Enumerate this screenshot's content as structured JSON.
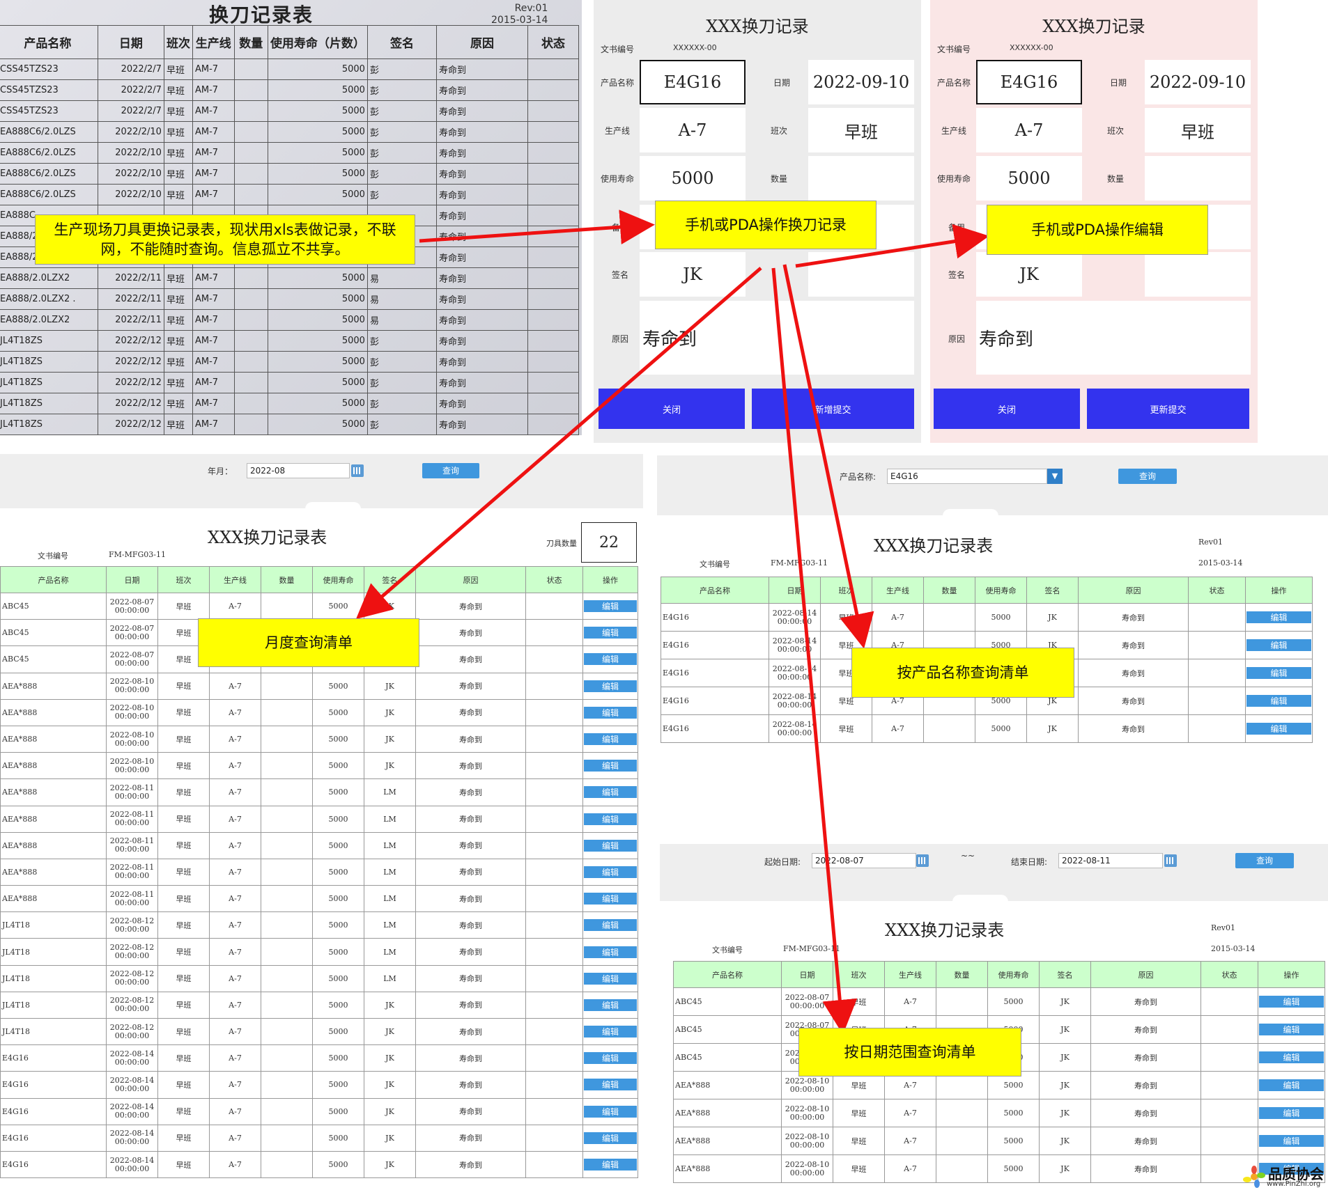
{
  "photo": {
    "title": "换刀记录表",
    "rev": "Rev:01",
    "date": "2015-03-14",
    "headers": [
      "产品名称",
      "日期",
      "班次",
      "生产线",
      "数量",
      "使用寿命（片数）",
      "签名",
      "原因",
      "状态"
    ],
    "rows": [
      [
        "CSS45TZS23",
        "2022/2/7",
        "早班",
        "AM-7",
        "",
        "5000",
        "彭",
        "寿命到",
        ""
      ],
      [
        "CSS45TZS23",
        "2022/2/7",
        "早班",
        "AM-7",
        "",
        "5000",
        "彭",
        "寿命到",
        ""
      ],
      [
        "CSS45TZS23",
        "2022/2/7",
        "早班",
        "AM-7",
        "",
        "5000",
        "彭",
        "寿命到",
        ""
      ],
      [
        "EA888C6/2.0LZS",
        "2022/2/10",
        "早班",
        "AM-7",
        "",
        "5000",
        "彭",
        "寿命到",
        ""
      ],
      [
        "EA888C6/2.0LZS",
        "2022/2/10",
        "早班",
        "AM-7",
        "",
        "5000",
        "彭",
        "寿命到",
        ""
      ],
      [
        "EA888C6/2.0LZS",
        "2022/2/10",
        "早班",
        "AM-7",
        "",
        "5000",
        "彭",
        "寿命到",
        ""
      ],
      [
        "EA888C6/2.0LZS",
        "2022/2/10",
        "早班",
        "AM-7",
        "",
        "5000",
        "彭",
        "寿命到",
        ""
      ],
      [
        "EA888C",
        "",
        "",
        "",
        "",
        "",
        "",
        "寿命到",
        ""
      ],
      [
        "EA888/2",
        "",
        "",
        "",
        "",
        "",
        "",
        "寿命到",
        ""
      ],
      [
        "EA888/2.0LZX2",
        "2022/2/11",
        "早班",
        "AM-7",
        "",
        "5000",
        "易",
        "寿命到",
        ""
      ],
      [
        "EA888/2.0LZX2",
        "2022/2/11",
        "早班",
        "AM-7",
        "",
        "5000",
        "易",
        "寿命到",
        ""
      ],
      [
        "EA888/2.0LZX2 .",
        "2022/2/11",
        "早班",
        "AM-7",
        "",
        "5000",
        "易",
        "寿命到",
        ""
      ],
      [
        "EA888/2.0LZX2",
        "2022/2/11",
        "早班",
        "AM-7",
        "",
        "5000",
        "易",
        "寿命到",
        ""
      ],
      [
        "JL4T18ZS",
        "2022/2/12",
        "早班",
        "AM-7",
        "",
        "5000",
        "彭",
        "寿命到",
        ""
      ],
      [
        "JL4T18ZS",
        "2022/2/12",
        "早班",
        "AM-7",
        "",
        "5000",
        "彭",
        "寿命到",
        ""
      ],
      [
        "JL4T18ZS",
        "2022/2/12",
        "早班",
        "AM-7",
        "",
        "5000",
        "彭",
        "寿命到",
        ""
      ],
      [
        "JL4T18ZS",
        "2022/2/12",
        "早班",
        "AM-7",
        "",
        "5000",
        "彭",
        "寿命到",
        ""
      ],
      [
        "JL4T18ZS",
        "2022/2/12",
        "早班",
        "AM-7",
        "",
        "5000",
        "彭",
        "寿命到",
        ""
      ]
    ]
  },
  "form_add": {
    "title": "XXX换刀记录",
    "doc_label": "文书编号",
    "doc_value": "XXXXXX-00",
    "product_label": "产品名称",
    "product_value": "E4G16",
    "date_label": "日期",
    "date_value": "2022-09-10",
    "line_label": "生产线",
    "line_value": "A-7",
    "shift_label": "班次",
    "shift_value": "早班",
    "life_label": "使用寿命",
    "life_value": "5000",
    "qty_label": "数量",
    "spare_label": "备用",
    "sign_label": "签名",
    "sign_value": "JK",
    "reason_label": "原因",
    "reason_value": "寿命到",
    "close_btn": "关闭",
    "submit_btn": "新增提交"
  },
  "form_edit": {
    "title": "XXX换刀记录",
    "doc_label": "文书编号",
    "doc_value": "XXXXXX-00",
    "product_label": "产品名称",
    "product_value": "E4G16",
    "date_label": "日期",
    "date_value": "2022-09-10",
    "line_label": "生产线",
    "line_value": "A-7",
    "shift_label": "班次",
    "shift_value": "早班",
    "life_label": "使用寿命",
    "life_value": "5000",
    "qty_label": "数量",
    "spare_label": "备用",
    "sign_label": "签名",
    "sign_value": "JK",
    "reason_label": "原因",
    "reason_value": "寿命到",
    "close_btn": "关闭",
    "submit_btn": "更新提交"
  },
  "callouts": {
    "photo": "生产现场刀具更换记录表，现状用xls表做记录，不联网，不能随时查询。信息孤立不共享。",
    "pda_add": "手机或PDA操作换刀记录",
    "pda_edit": "手机或PDA操作编辑",
    "monthly": "月度查询清单",
    "by_product": "按产品名称查询清单",
    "by_date": "按日期范围查询清单"
  },
  "monthly": {
    "query_label": "年月：",
    "query_value": "2022-08",
    "query_btn": "查询",
    "title": "XXX换刀记录表",
    "doc_label": "文书编号",
    "doc_value": "FM-MFG03-11",
    "count_label": "刀具数量",
    "count_value": "22",
    "headers": [
      "产品名称",
      "日期",
      "班次",
      "生产线",
      "数量",
      "使用寿命",
      "签名",
      "原因",
      "状态",
      "操作"
    ],
    "edit_label": "编辑",
    "rows": [
      [
        "ABC45",
        "2022-08-07",
        "00:00:00",
        "早班",
        "A-7",
        "",
        "5000",
        "JK",
        "寿命到",
        ""
      ],
      [
        "ABC45",
        "2022-08-07",
        "00:00:00",
        "早班",
        "A-7",
        "",
        "5000",
        "JK",
        "寿命到",
        ""
      ],
      [
        "ABC45",
        "2022-08-07",
        "00:00:00",
        "早班",
        "A-7",
        "",
        "5000",
        "JK",
        "寿命到",
        ""
      ],
      [
        "AEA*888",
        "2022-08-10",
        "00:00:00",
        "早班",
        "A-7",
        "",
        "5000",
        "JK",
        "寿命到",
        ""
      ],
      [
        "AEA*888",
        "2022-08-10",
        "00:00:00",
        "早班",
        "A-7",
        "",
        "5000",
        "JK",
        "寿命到",
        ""
      ],
      [
        "AEA*888",
        "2022-08-10",
        "00:00:00",
        "早班",
        "A-7",
        "",
        "5000",
        "JK",
        "寿命到",
        ""
      ],
      [
        "AEA*888",
        "2022-08-10",
        "00:00:00",
        "早班",
        "A-7",
        "",
        "5000",
        "JK",
        "寿命到",
        ""
      ],
      [
        "AEA*888",
        "2022-08-11",
        "00:00:00",
        "早班",
        "A-7",
        "",
        "5000",
        "LM",
        "寿命到",
        ""
      ],
      [
        "AEA*888",
        "2022-08-11",
        "00:00:00",
        "早班",
        "A-7",
        "",
        "5000",
        "LM",
        "寿命到",
        ""
      ],
      [
        "AEA*888",
        "2022-08-11",
        "00:00:00",
        "早班",
        "A-7",
        "",
        "5000",
        "LM",
        "寿命到",
        ""
      ],
      [
        "AEA*888",
        "2022-08-11",
        "00:00:00",
        "早班",
        "A-7",
        "",
        "5000",
        "LM",
        "寿命到",
        ""
      ],
      [
        "AEA*888",
        "2022-08-11",
        "00:00:00",
        "早班",
        "A-7",
        "",
        "5000",
        "LM",
        "寿命到",
        ""
      ],
      [
        "JL4T18",
        "2022-08-12",
        "00:00:00",
        "早班",
        "A-7",
        "",
        "5000",
        "LM",
        "寿命到",
        ""
      ],
      [
        "JL4T18",
        "2022-08-12",
        "00:00:00",
        "早班",
        "A-7",
        "",
        "5000",
        "LM",
        "寿命到",
        ""
      ],
      [
        "JL4T18",
        "2022-08-12",
        "00:00:00",
        "早班",
        "A-7",
        "",
        "5000",
        "LM",
        "寿命到",
        ""
      ],
      [
        "JL4T18",
        "2022-08-12",
        "00:00:00",
        "早班",
        "A-7",
        "",
        "5000",
        "JK",
        "寿命到",
        ""
      ],
      [
        "JL4T18",
        "2022-08-12",
        "00:00:00",
        "早班",
        "A-7",
        "",
        "5000",
        "JK",
        "寿命到",
        ""
      ],
      [
        "E4G16",
        "2022-08-14",
        "00:00:00",
        "早班",
        "A-7",
        "",
        "5000",
        "JK",
        "寿命到",
        ""
      ],
      [
        "E4G16",
        "2022-08-14",
        "00:00:00",
        "早班",
        "A-7",
        "",
        "5000",
        "JK",
        "寿命到",
        ""
      ],
      [
        "E4G16",
        "2022-08-14",
        "00:00:00",
        "早班",
        "A-7",
        "",
        "5000",
        "JK",
        "寿命到",
        ""
      ],
      [
        "E4G16",
        "2022-08-14",
        "00:00:00",
        "早班",
        "A-7",
        "",
        "5000",
        "JK",
        "寿命到",
        ""
      ],
      [
        "E4G16",
        "2022-08-14",
        "00:00:00",
        "早班",
        "A-7",
        "",
        "5000",
        "JK",
        "寿命到",
        ""
      ]
    ]
  },
  "by_product": {
    "query_label": "产品名称:",
    "query_value": "E4G16",
    "query_btn": "查询",
    "title": "XXX换刀记录表",
    "rev": "Rev01",
    "date": "2015-03-14",
    "doc_label": "文书编号",
    "doc_value": "FM-MFG03-11",
    "headers": [
      "产品名称",
      "日期",
      "班次",
      "生产线",
      "数量",
      "使用寿命",
      "签名",
      "原因",
      "状态",
      "操作"
    ],
    "edit_label": "编辑",
    "rows": [
      [
        "E4G16",
        "2022-08-14",
        "00:00:00",
        "早班",
        "A-7",
        "",
        "5000",
        "JK",
        "寿命到",
        ""
      ],
      [
        "E4G16",
        "2022-08-14",
        "00:00:00",
        "早班",
        "A-7",
        "",
        "5000",
        "JK",
        "寿命到",
        ""
      ],
      [
        "E4G16",
        "2022-08-14",
        "00:00:00",
        "早班",
        "A-7",
        "",
        "5000",
        "JK",
        "寿命到",
        ""
      ],
      [
        "E4G16",
        "2022-08-14",
        "00:00:00",
        "早班",
        "A-7",
        "",
        "5000",
        "JK",
        "寿命到",
        ""
      ],
      [
        "E4G16",
        "2022-08-14",
        "00:00:00",
        "早班",
        "A-7",
        "",
        "5000",
        "JK",
        "寿命到",
        ""
      ]
    ]
  },
  "by_date": {
    "start_label": "起始日期:",
    "start_value": "2022-08-07",
    "tilde": "~~",
    "end_label": "结束日期:",
    "end_value": "2022-08-11",
    "query_btn": "查询",
    "title": "XXX换刀记录表",
    "rev": "Rev01",
    "date": "2015-03-14",
    "doc_label": "文书编号",
    "doc_value": "FM-MFG03-11",
    "headers": [
      "产品名称",
      "日期",
      "班次",
      "生产线",
      "数量",
      "使用寿命",
      "签名",
      "原因",
      "状态",
      "操作"
    ],
    "edit_label": "编辑",
    "rows": [
      [
        "ABC45",
        "2022-08-07",
        "00:00:00",
        "早班",
        "A-7",
        "",
        "5000",
        "JK",
        "寿命到",
        ""
      ],
      [
        "ABC45",
        "2022-08-07",
        "00:00:00",
        "早班",
        "A-7",
        "",
        "5000",
        "JK",
        "寿命到",
        ""
      ],
      [
        "ABC45",
        "2022-08-07",
        "00:00:00",
        "早班",
        "A-7",
        "",
        "5000",
        "JK",
        "寿命到",
        ""
      ],
      [
        "AEA*888",
        "2022-08-10",
        "00:00:00",
        "早班",
        "A-7",
        "",
        "5000",
        "JK",
        "寿命到",
        ""
      ],
      [
        "AEA*888",
        "2022-08-10",
        "00:00:00",
        "早班",
        "A-7",
        "",
        "5000",
        "JK",
        "寿命到",
        ""
      ],
      [
        "AEA*888",
        "2022-08-10",
        "00:00:00",
        "早班",
        "A-7",
        "",
        "5000",
        "JK",
        "寿命到",
        ""
      ],
      [
        "AEA*888",
        "2022-08-10",
        "00:00:00",
        "早班",
        "A-7",
        "",
        "5000",
        "JK",
        "寿命到",
        ""
      ]
    ]
  },
  "logo": {
    "name": "品质协会",
    "url": "www.PinZhi.org"
  },
  "colors": {
    "arrow": "#ee1111",
    "callout": "#ffff00",
    "table_header": "#ccffcc",
    "edit_button": "#3f97de",
    "form_button": "#3333ee"
  }
}
